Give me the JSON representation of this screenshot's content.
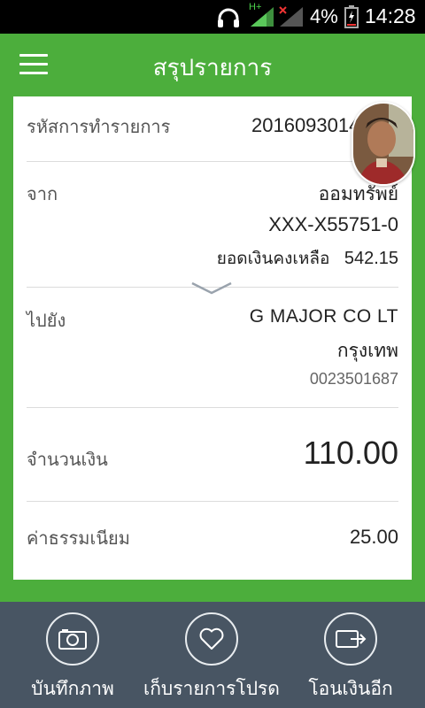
{
  "status_bar": {
    "network_label": "H+",
    "battery_percent": "4%",
    "time": "14:28"
  },
  "header": {
    "title": "สรุปรายการ"
  },
  "transaction": {
    "id_label": "รหัสการทำรายการ",
    "id_value": "20160930142636",
    "from_label": "จาก",
    "from_account_type": "ออมทรัพย์",
    "from_account_number": "XXX-X55751-0",
    "balance_label": "ยอดเงินคงเหลือ",
    "balance_value": "542.15",
    "to_label": "ไปยัง",
    "to_name": "G MAJOR CO LT",
    "to_bank": "กรุงเทพ",
    "to_account": "0023501687",
    "amount_label": "จำนวนเงิน",
    "amount_value": "110.00",
    "fee_label": "ค่าธรรมเนียม",
    "fee_value": "25.00"
  },
  "actions": {
    "save_image": "บันทึกภาพ",
    "save_favorite": "เก็บรายการโปรด",
    "transfer_again": "โอนเงินอีก"
  },
  "colors": {
    "header_green": "#4cae3c",
    "bottom_bar": "#485563"
  }
}
